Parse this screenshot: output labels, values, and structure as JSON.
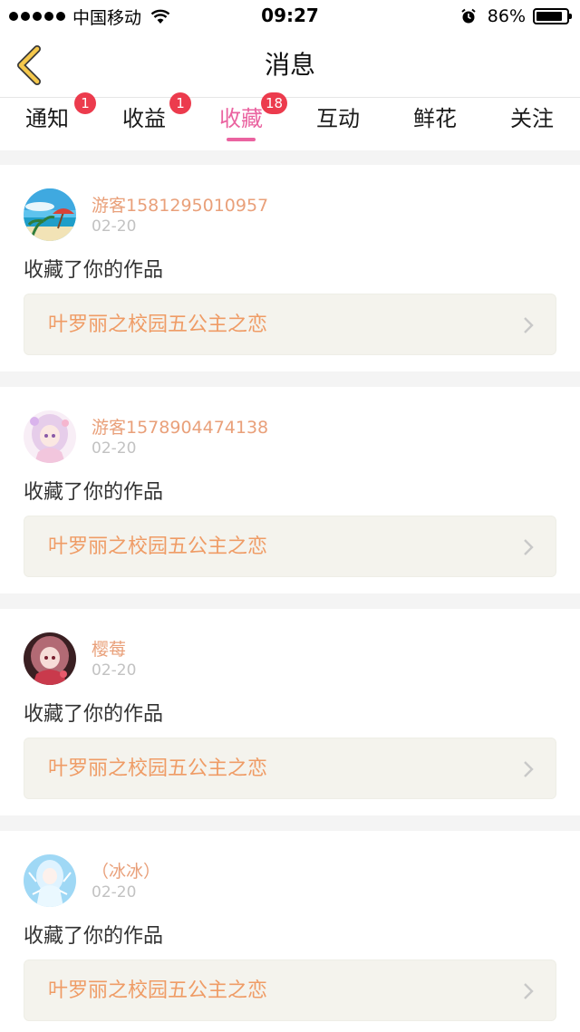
{
  "status_bar": {
    "carrier": "中国移动",
    "time": "09:27",
    "battery": "86%",
    "battery_level": 0.86
  },
  "nav": {
    "title": "消息"
  },
  "tabs": [
    {
      "label": "通知",
      "badge": "1"
    },
    {
      "label": "收益",
      "badge": "1"
    },
    {
      "label": "收藏",
      "badge": "18"
    },
    {
      "label": "互动",
      "badge": ""
    },
    {
      "label": "鲜花",
      "badge": ""
    },
    {
      "label": "关注",
      "badge": ""
    }
  ],
  "active_tab": "收藏",
  "colors": {
    "accent": "#ea63a0",
    "badge": "#ec3b4d",
    "username": "#e9a07a",
    "work_title": "#ef9c66"
  },
  "messages": [
    {
      "username": "游客1581295010957",
      "date": "02-20",
      "action": "收藏了你的作品",
      "work_title": "叶罗丽之校园五公主之恋",
      "avatar_icon": "beach-avatar-icon"
    },
    {
      "username": "游客1578904474138",
      "date": "02-20",
      "action": "收藏了你的作品",
      "work_title": "叶罗丽之校园五公主之恋",
      "avatar_icon": "anime-girl-avatar-icon"
    },
    {
      "username": "樱莓",
      "date": "02-20",
      "action": "收藏了你的作品",
      "work_title": "叶罗丽之校园五公主之恋",
      "avatar_icon": "anime-girl-dark-avatar-icon"
    },
    {
      "username": "（冰冰）",
      "date": "02-20",
      "action": "收藏了你的作品",
      "work_title": "叶罗丽之校园五公主之恋",
      "avatar_icon": "ice-fairy-avatar-icon"
    }
  ]
}
